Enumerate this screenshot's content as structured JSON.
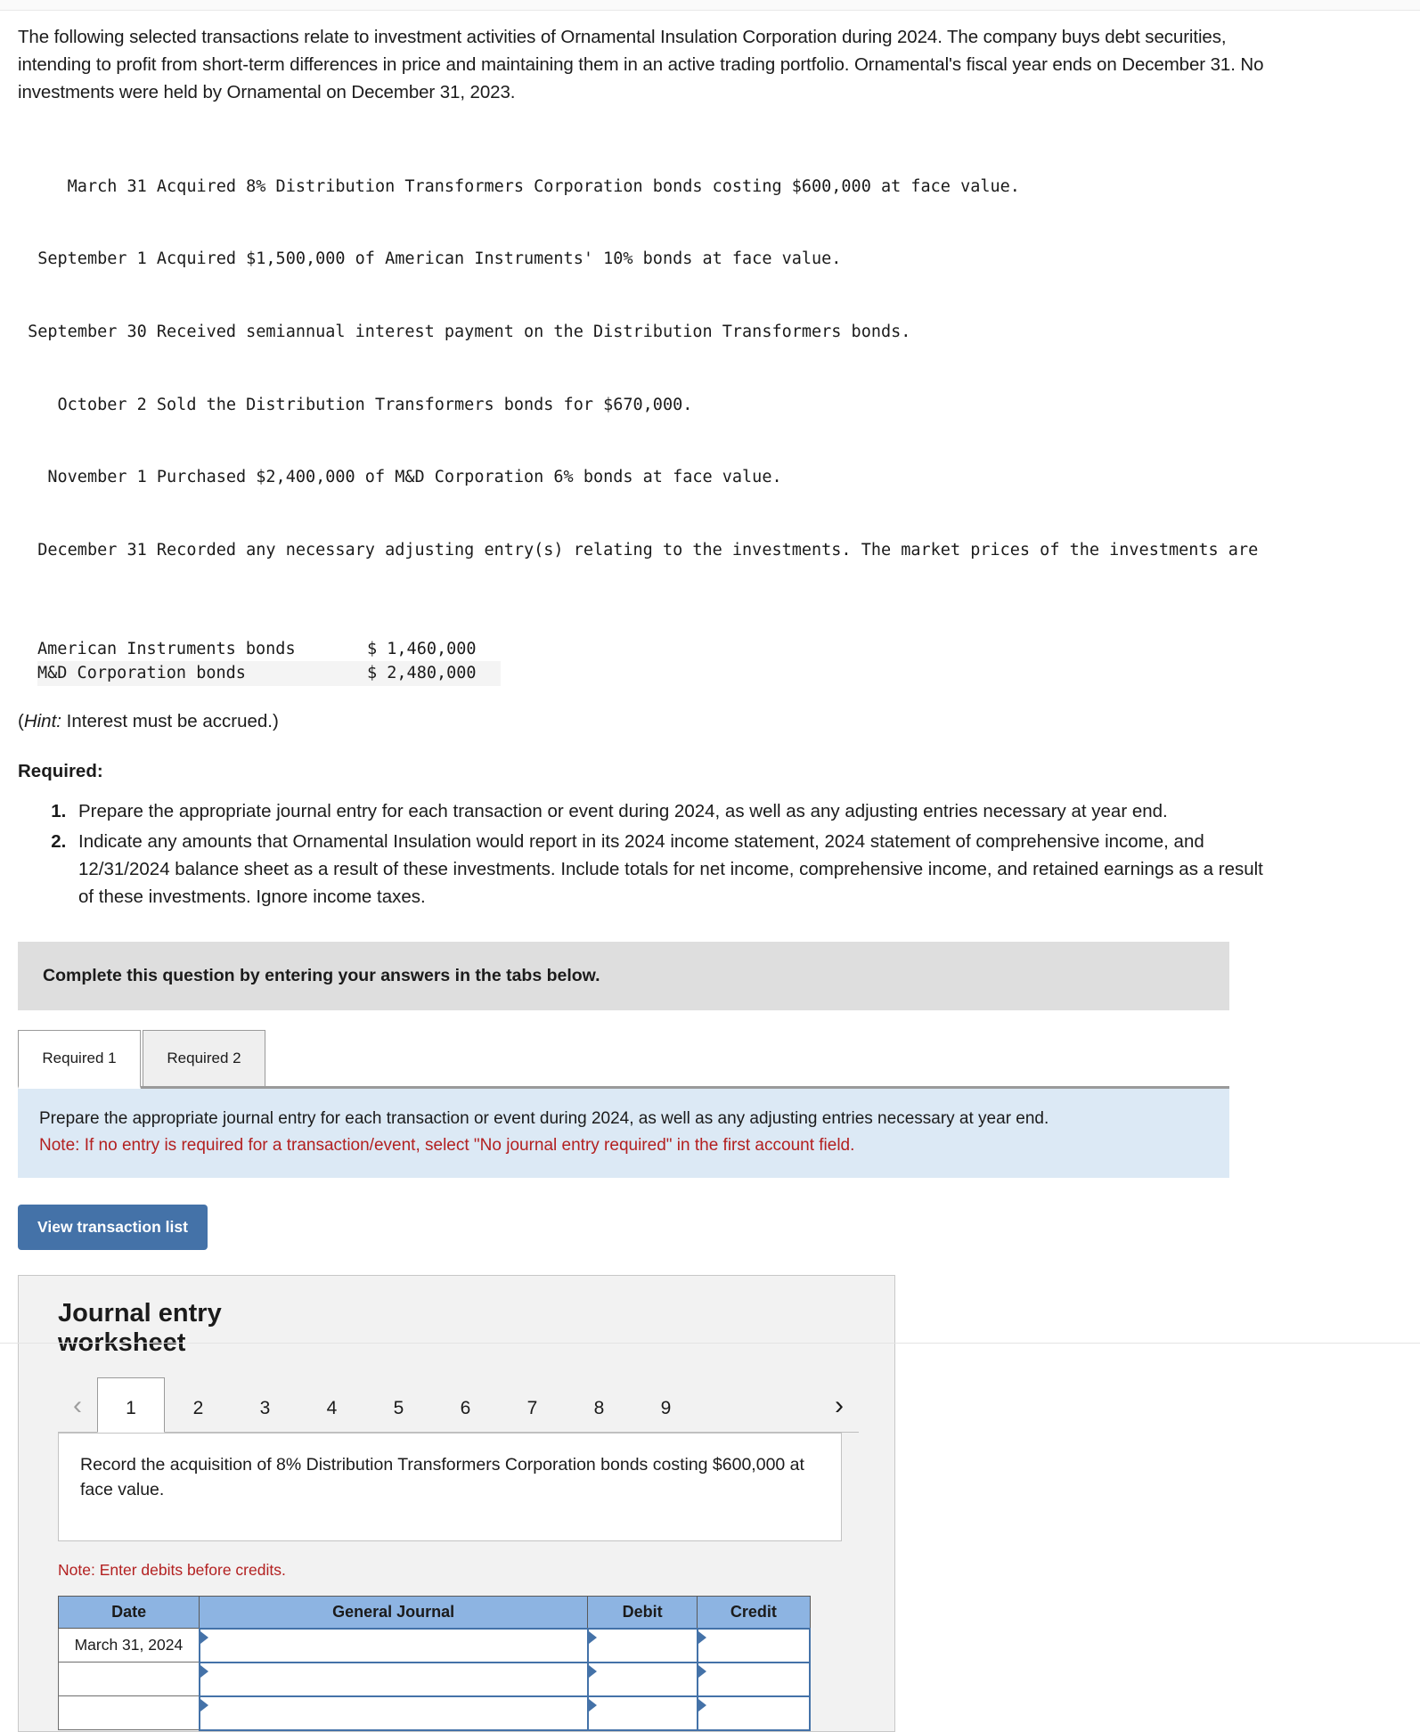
{
  "intro": "The following selected transactions relate to investment activities of Ornamental Insulation Corporation during 2024. The company buys debt securities, intending to profit from short-term differences in price and maintaining them in an active trading portfolio. Ornamental's fiscal year ends on December 31. No investments were held by Ornamental on December 31, 2023.",
  "transactions": [
    {
      "date": "March 31",
      "description": "Acquired 8% Distribution Transformers Corporation bonds costing $600,000 at face value."
    },
    {
      "date": "September 1",
      "description": "Acquired $1,500,000 of American Instruments' 10% bonds at face value."
    },
    {
      "date": "September 30",
      "description": "Received semiannual interest payment on the Distribution Transformers bonds."
    },
    {
      "date": "October 2",
      "description": "Sold the Distribution Transformers bonds for $670,000."
    },
    {
      "date": "November 1",
      "description": "Purchased $2,400,000 of M&D Corporation 6% bonds at face value."
    },
    {
      "date": "December 31",
      "description": "Recorded any necessary adjusting entry(s) relating to the investments. The market prices of the investments are"
    }
  ],
  "market_prices": [
    {
      "label": "American Instruments bonds",
      "amount": "$ 1,460,000"
    },
    {
      "label": "M&D Corporation bonds",
      "amount": "$ 2,480,000"
    }
  ],
  "hint": {
    "prefix": "(",
    "emphasis": "Hint:",
    "text": " Interest must be accrued.)"
  },
  "required": {
    "heading": "Required:",
    "items": [
      "Prepare the appropriate journal entry for each transaction or event during 2024, as well as any adjusting entries necessary at year end.",
      "Indicate any amounts that Ornamental Insulation would report in its 2024 income statement, 2024 statement of comprehensive income, and 12/31/2024 balance sheet as a result of these investments. Include totals for net income, comprehensive income, and retained earnings as a result of these investments. Ignore income taxes."
    ]
  },
  "banner": "Complete this question by entering your answers in the tabs below.",
  "tabs": [
    {
      "label": "Required 1",
      "active": true
    },
    {
      "label": "Required 2",
      "active": false
    }
  ],
  "instruction": {
    "text": "Prepare the appropriate journal entry for each transaction or event during 2024, as well as any adjusting entries necessary at year end.",
    "note": "Note: If no entry is required for a transaction/event, select \"No journal entry required\" in the first account field."
  },
  "view_transaction_button": "View transaction list",
  "worksheet": {
    "title": "Journal entry worksheet",
    "prev_arrow": "‹",
    "next_arrow": "›",
    "pages": [
      "1",
      "2",
      "3",
      "4",
      "5",
      "6",
      "7",
      "8",
      "9"
    ],
    "active_page": "1",
    "transaction_description": "Record the acquisition of 8% Distribution Transformers Corporation bonds costing $600,000 at face value.",
    "debit_note": "Note: Enter debits before credits.",
    "table": {
      "headers": [
        "Date",
        "General Journal",
        "Debit",
        "Credit"
      ],
      "rows": [
        {
          "date": "March 31, 2024",
          "general_journal": "",
          "debit": "",
          "credit": ""
        },
        {
          "date": "",
          "general_journal": "",
          "debit": "",
          "credit": ""
        },
        {
          "date": "",
          "general_journal": "",
          "debit": "",
          "credit": ""
        }
      ]
    }
  },
  "colors": {
    "accent_blue": "#4472a8",
    "header_blue": "#8db4e2",
    "panel_blue": "#dce9f5",
    "banner_grey": "#dedede",
    "note_red": "#b32020"
  }
}
